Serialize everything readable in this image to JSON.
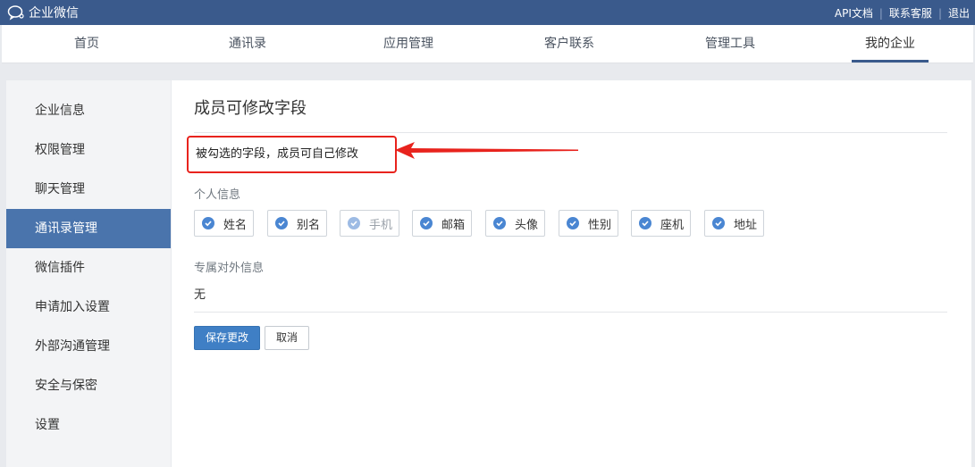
{
  "topbar": {
    "brand": "企业微信",
    "links": [
      "API文档",
      "联系客服",
      "退出"
    ]
  },
  "nav": {
    "items": [
      "首页",
      "通讯录",
      "应用管理",
      "客户联系",
      "管理工具",
      "我的企业"
    ],
    "active": "我的企业"
  },
  "sidebar": {
    "items": [
      "企业信息",
      "权限管理",
      "聊天管理",
      "通讯录管理",
      "微信插件",
      "申请加入设置",
      "外部沟通管理",
      "安全与保密",
      "设置"
    ],
    "active": "通讯录管理"
  },
  "main": {
    "title": "成员可修改字段",
    "hint": "被勾选的字段，成员可自己修改",
    "personal_label": "个人信息",
    "fields": [
      {
        "label": "姓名",
        "checked": true,
        "disabled": false
      },
      {
        "label": "别名",
        "checked": true,
        "disabled": false
      },
      {
        "label": "手机",
        "checked": true,
        "disabled": true
      },
      {
        "label": "邮箱",
        "checked": true,
        "disabled": false
      },
      {
        "label": "头像",
        "checked": true,
        "disabled": false
      },
      {
        "label": "性别",
        "checked": true,
        "disabled": false
      },
      {
        "label": "座机",
        "checked": true,
        "disabled": false
      },
      {
        "label": "地址",
        "checked": true,
        "disabled": false
      }
    ],
    "external_label": "专属对外信息",
    "external_value": "无",
    "save_label": "保存更改",
    "cancel_label": "取消"
  },
  "colors": {
    "topbar": "#3a5a8c",
    "sidebar_active": "#4a74ac",
    "primary_button": "#3f7fc5",
    "check": "#4a86d2",
    "annotation": "#e8231d"
  },
  "icons": {
    "brand": "chat-bubble-icon",
    "check": "check-circle-icon",
    "annotation": "red-arrow-icon"
  }
}
